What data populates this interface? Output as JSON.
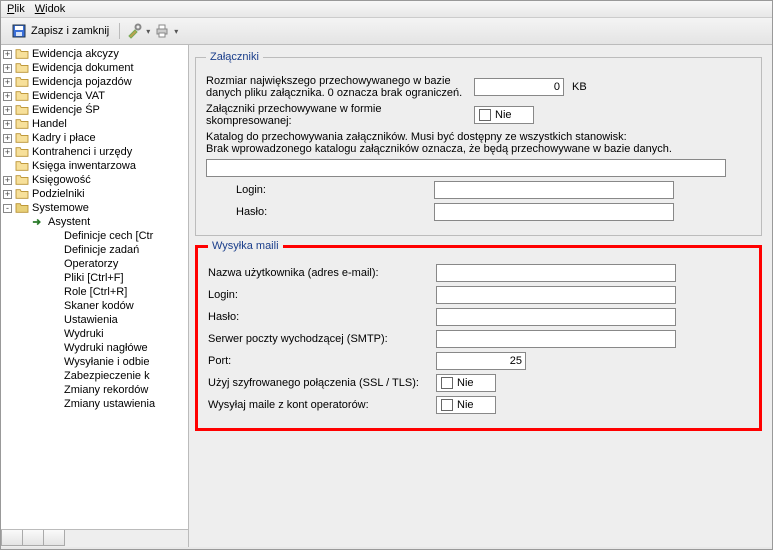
{
  "menu": {
    "file": "Plik",
    "view": "Widok"
  },
  "toolbar": {
    "save_close": "Zapisz i zamknij"
  },
  "tree": [
    {
      "lvl": 0,
      "exp": "+",
      "icon": "folder",
      "label": "Ewidencja akcyzy"
    },
    {
      "lvl": 0,
      "exp": "+",
      "icon": "folder",
      "label": "Ewidencja dokument"
    },
    {
      "lvl": 0,
      "exp": "+",
      "icon": "folder",
      "label": "Ewidencja pojazdów"
    },
    {
      "lvl": 0,
      "exp": "+",
      "icon": "folder",
      "label": "Ewidencja VAT"
    },
    {
      "lvl": 0,
      "exp": "+",
      "icon": "folder",
      "label": "Ewidencje ŚP"
    },
    {
      "lvl": 0,
      "exp": "+",
      "icon": "folder",
      "label": "Handel"
    },
    {
      "lvl": 0,
      "exp": "+",
      "icon": "folder",
      "label": "Kadry i płace"
    },
    {
      "lvl": 0,
      "exp": "+",
      "icon": "folder",
      "label": "Kontrahenci i urzędy"
    },
    {
      "lvl": 0,
      "exp": "",
      "icon": "folder",
      "label": "Księga inwentarzowa"
    },
    {
      "lvl": 0,
      "exp": "+",
      "icon": "folder",
      "label": "Księgowość"
    },
    {
      "lvl": 0,
      "exp": "+",
      "icon": "folder",
      "label": "Podzielniki"
    },
    {
      "lvl": 0,
      "exp": "-",
      "icon": "folder-open",
      "label": "Systemowe"
    },
    {
      "lvl": 1,
      "exp": "",
      "icon": "arrow",
      "label": "Asystent"
    },
    {
      "lvl": 2,
      "exp": "",
      "icon": "",
      "label": "Definicje cech [Ctr"
    },
    {
      "lvl": 2,
      "exp": "",
      "icon": "",
      "label": "Definicje zadań"
    },
    {
      "lvl": 2,
      "exp": "",
      "icon": "",
      "label": "Operatorzy"
    },
    {
      "lvl": 2,
      "exp": "",
      "icon": "",
      "label": "Pliki [Ctrl+F]"
    },
    {
      "lvl": 2,
      "exp": "",
      "icon": "",
      "label": "Role [Ctrl+R]"
    },
    {
      "lvl": 2,
      "exp": "",
      "icon": "",
      "label": "Skaner kodów"
    },
    {
      "lvl": 2,
      "exp": "",
      "icon": "",
      "label": "Ustawienia"
    },
    {
      "lvl": 2,
      "exp": "",
      "icon": "",
      "label": "Wydruki"
    },
    {
      "lvl": 2,
      "exp": "",
      "icon": "",
      "label": "Wydruki nagłówe"
    },
    {
      "lvl": 2,
      "exp": "",
      "icon": "",
      "label": "Wysyłanie i odbie"
    },
    {
      "lvl": 2,
      "exp": "",
      "icon": "",
      "label": "Zabezpieczenie k"
    },
    {
      "lvl": 2,
      "exp": "",
      "icon": "",
      "label": "Zmiany rekordów"
    },
    {
      "lvl": 2,
      "exp": "",
      "icon": "",
      "label": "Zmiany ustawienia"
    }
  ],
  "attachments": {
    "legend": "Załączniki",
    "size_label": "Rozmiar największego przechowywanego w bazie danych pliku załącznika. 0 oznacza brak ograniczeń.",
    "size_value": "0",
    "size_unit": "KB",
    "compressed_label": "Załączniki przechowywane w formie skompresowanej:",
    "compressed_value": "Nie",
    "dir_label": "Katalog do przechowywania załączników. Musi być dostępny ze wszystkich stanowisk:",
    "dir_hint": "Brak wprowadzonego katalogu załączników oznacza, że będą przechowywane w bazie danych.",
    "dir_value": "",
    "login_label": "Login:",
    "login_value": "",
    "password_label": "Hasło:",
    "password_value": ""
  },
  "mail": {
    "legend": "Wysyłka maili",
    "user_label": "Nazwa użytkownika (adres e-mail):",
    "user_value": "",
    "login_label": "Login:",
    "login_value": "",
    "password_label": "Hasło:",
    "password_value": "",
    "smtp_label": "Serwer poczty wychodzącej (SMTP):",
    "smtp_value": "",
    "port_label": "Port:",
    "port_value": "25",
    "ssl_label": "Użyj szyfrowanego połączenia (SSL / TLS):",
    "ssl_value": "Nie",
    "operators_label": "Wysyłaj maile z kont operatorów:",
    "operators_value": "Nie"
  }
}
